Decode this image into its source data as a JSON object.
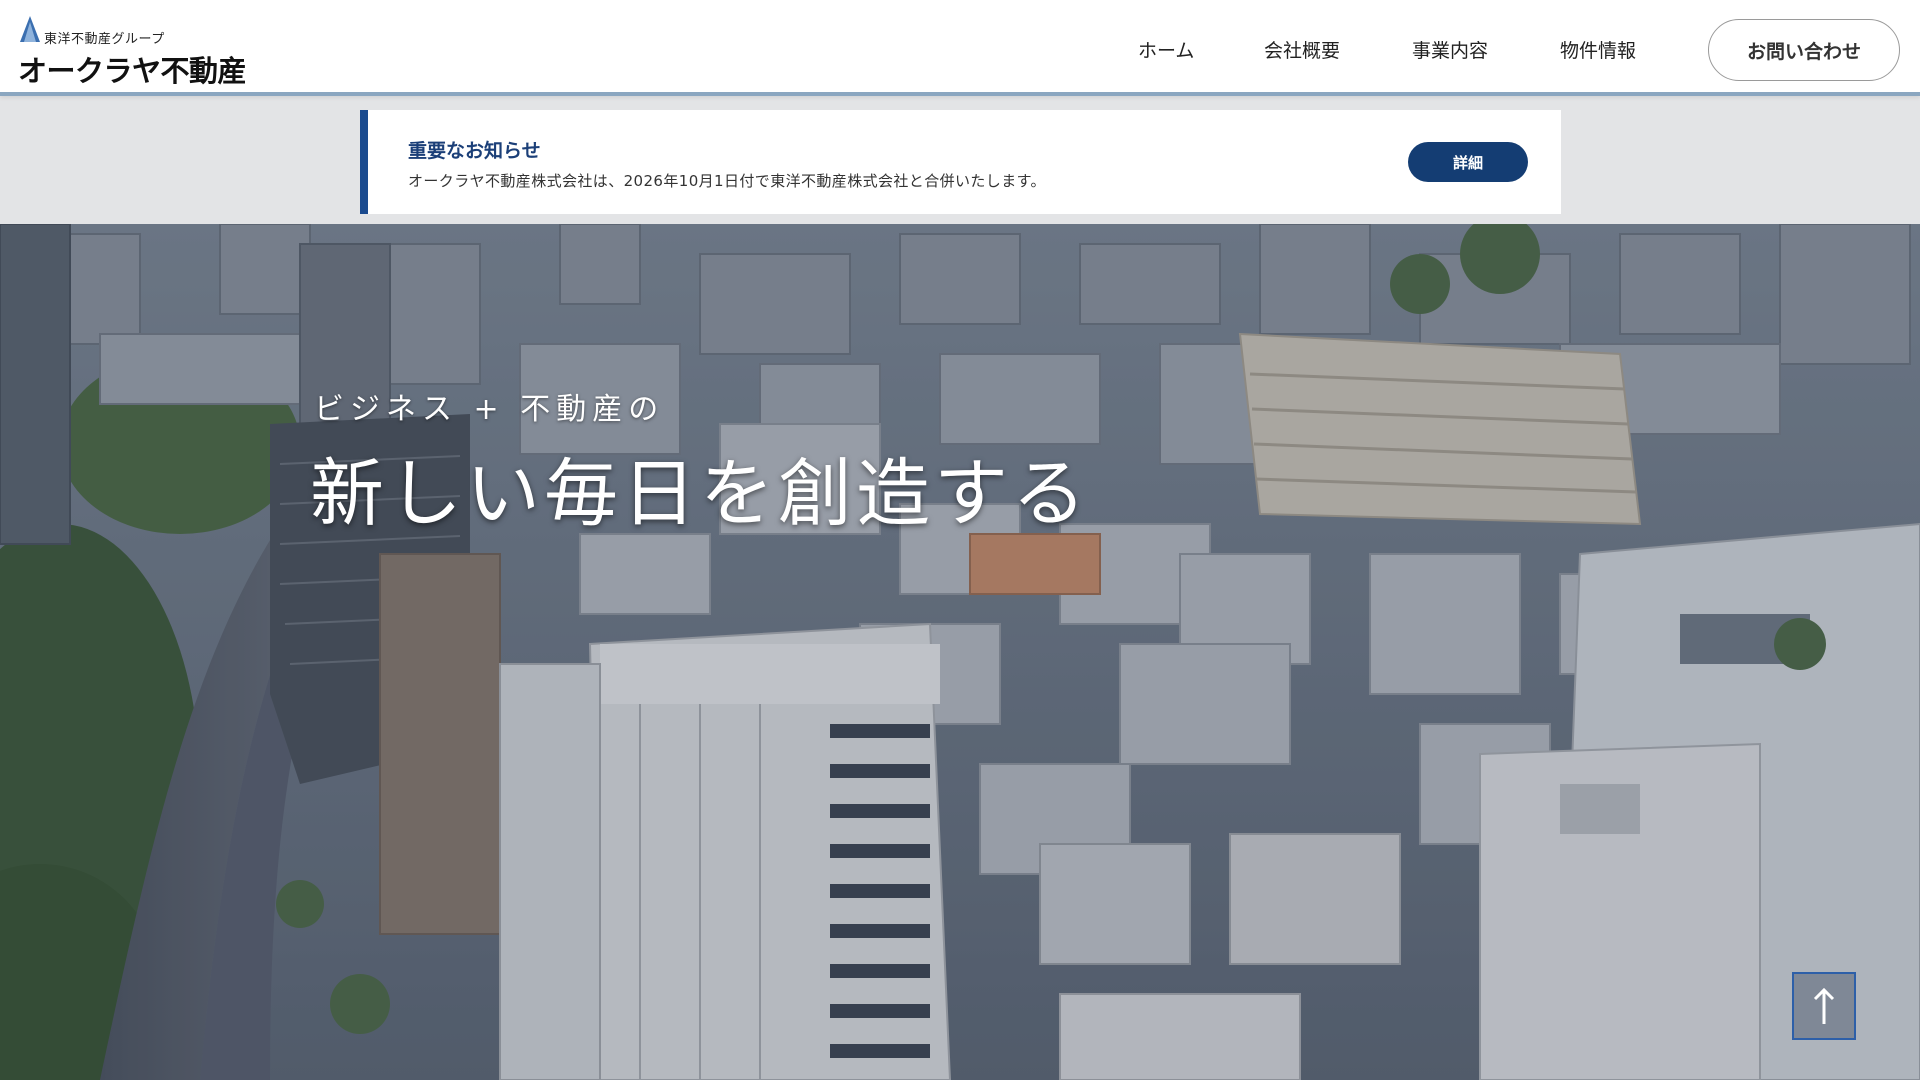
{
  "header": {
    "logo_small": "東洋不動産グループ",
    "logo_main": "オークラヤ不動産",
    "nav": [
      {
        "label": "ホーム"
      },
      {
        "label": "会社概要"
      },
      {
        "label": "事業内容"
      },
      {
        "label": "物件情報"
      }
    ],
    "contact_label": "お問い合わせ"
  },
  "notice": {
    "title": "重要なお知らせ",
    "text": "オークラヤ不動産株式会社は、2026年10月1日付で東洋不動産株式会社と合併いたします。",
    "button_label": "詳細"
  },
  "hero": {
    "subtitle": "ビジネス + 不動産の",
    "title": "新しい毎日を創造する"
  },
  "scroll_top_icon": "arrow-up-icon",
  "colors": {
    "brand_navy": "#143d73",
    "notice_border": "#1b4b8f",
    "header_border": "#8aa6c0"
  }
}
